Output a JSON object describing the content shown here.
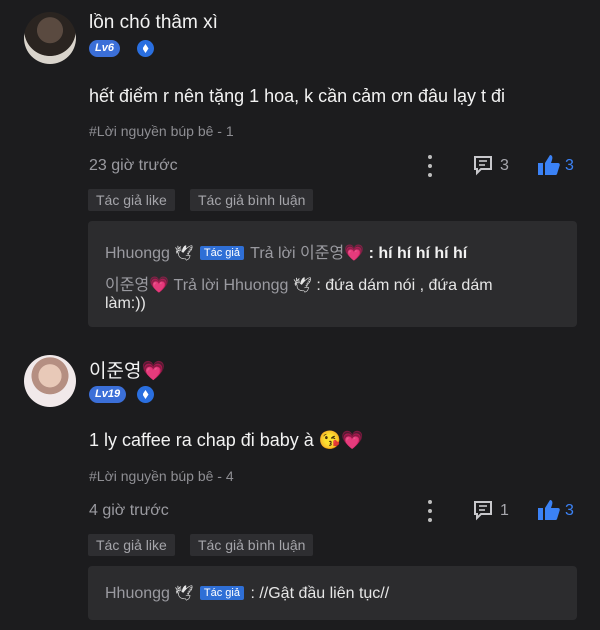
{
  "comments": [
    {
      "username": "lồn chó thâm xì",
      "level": "Lv6",
      "text": "hết điểm r nên tặng 1 hoa, k cần cảm ơn đâu lạy t đi",
      "tag": "#Lời nguyền búp bê - 1",
      "time": "23 giờ trước",
      "comment_count": "3",
      "like_count": "3",
      "chips": [
        "Tác giả like",
        "Tác giả bình luận"
      ],
      "replies": [
        {
          "from": "Hhuongg",
          "badge": "Tác giả",
          "verb": "Trả lời",
          "to": "이준영",
          "message": ": hí hí hí hí hí"
        },
        {
          "from": "이준영",
          "verb": "Trả lời",
          "to": "Hhuongg",
          "message_line1": ": đứa dám nói , đứa dám",
          "message_line2": "làm:))"
        }
      ]
    },
    {
      "username": "이준영",
      "level": "Lv19",
      "text": "1 ly caffee ra chap đi baby à",
      "tag": "#Lời nguyền búp bê - 4",
      "time": "4 giờ trước",
      "comment_count": "1",
      "like_count": "3",
      "chips": [
        "Tác giả like",
        "Tác giả bình luận"
      ],
      "replies": [
        {
          "from": "Hhuongg",
          "badge": "Tác giả",
          "message": ": //Gật đầu liên tục//"
        }
      ]
    }
  ],
  "colors": {
    "background": "#1c1c1e",
    "accent": "#3b82f6",
    "heart": "#ff4fa3"
  },
  "icons": [
    "more-vertical-icon",
    "comment-icon",
    "thumbs-up-icon",
    "dove-icon",
    "heart-emoji",
    "kiss-emoji",
    "gem-badge-icon"
  ]
}
